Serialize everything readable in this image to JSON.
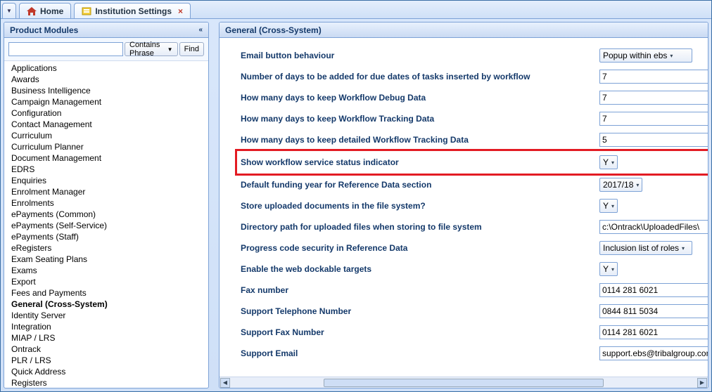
{
  "tabs": {
    "home_label": "Home",
    "settings_label": "Institution Settings"
  },
  "sidebar": {
    "title": "Product Modules",
    "filter_mode": "Contains Phrase",
    "find_label": "Find",
    "selected_module": "General (Cross-System)",
    "items": [
      "Applications",
      "Awards",
      "Business Intelligence",
      "Campaign Management",
      "Configuration",
      "Contact Management",
      "Curriculum",
      "Curriculum Planner",
      "Document Management",
      "EDRS",
      "Enquiries",
      "Enrolment Manager",
      "Enrolments",
      "ePayments (Common)",
      "ePayments (Self-Service)",
      "ePayments (Staff)",
      "eRegisters",
      "Exam Seating Plans",
      "Exams",
      "Export",
      "Fees and Payments",
      "General (Cross-System)",
      "Identity Server",
      "Integration",
      "MIAP / LRS",
      "Ontrack",
      "PLR / LRS",
      "Quick Address",
      "Registers"
    ]
  },
  "settings": {
    "title": "General (Cross-System)",
    "rows": [
      {
        "label": "Email button behaviour",
        "type": "select",
        "value": "Popup within ebs",
        "cls": "wide"
      },
      {
        "label": "Number of days to be added for due dates of tasks inserted by workflow",
        "type": "text",
        "value": "7"
      },
      {
        "label": "How many days to keep Workflow Debug Data",
        "type": "text",
        "value": "7"
      },
      {
        "label": "How many days to keep Workflow Tracking Data",
        "type": "text",
        "value": "7"
      },
      {
        "label": "How many days to keep detailed Workflow Tracking Data",
        "type": "text",
        "value": "5"
      },
      {
        "label": "Show workflow service status indicator",
        "type": "select",
        "value": "Y",
        "cls": "mini",
        "highlight": true
      },
      {
        "label": "Default funding year for Reference Data section",
        "type": "select",
        "value": "2017/18",
        "cls": "mid"
      },
      {
        "label": "Store uploaded documents in the file system?",
        "type": "select",
        "value": "Y",
        "cls": "mini"
      },
      {
        "label": "Directory path for uploaded files when storing to file system",
        "type": "text",
        "value": "c:\\Ontrack\\UploadedFiles\\"
      },
      {
        "label": "Progress code security in Reference Data",
        "type": "select",
        "value": "Inclusion list of roles",
        "cls": "wide"
      },
      {
        "label": "Enable the web dockable targets",
        "type": "select",
        "value": "Y",
        "cls": "mini"
      },
      {
        "label": "Fax number",
        "type": "text",
        "value": "0114 281 6021"
      },
      {
        "label": "Support Telephone Number",
        "type": "text",
        "value": "0844 811 5034"
      },
      {
        "label": "Support Fax Number",
        "type": "text",
        "value": "0114 281 6021"
      },
      {
        "label": "Support Email",
        "type": "text",
        "value": "support.ebs@tribalgroup.com"
      }
    ]
  }
}
